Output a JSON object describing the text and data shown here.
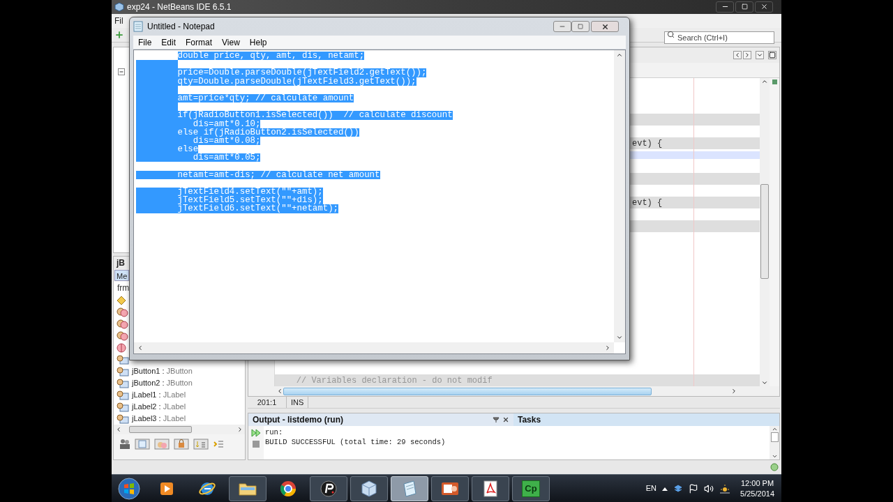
{
  "ide": {
    "title": "exp24 - NetBeans IDE 6.5.1",
    "menu": [
      "Fil"
    ],
    "search": {
      "placeholder": "Search (Ctrl+I)"
    },
    "inspector": {
      "header": "jB",
      "tabs": [
        {
          "label": "Me",
          "selected": true
        }
      ],
      "root": "frm",
      "items": [
        {
          "kind": "form"
        },
        {
          "kind": "bean"
        },
        {
          "kind": "bean"
        },
        {
          "kind": "bean"
        },
        {
          "kind": "separator"
        },
        {
          "kind": "component"
        },
        {
          "kind": "component",
          "name": "jButton1 :",
          "type": "JButton"
        },
        {
          "kind": "component",
          "name": "jButton2 :",
          "type": "JButton"
        },
        {
          "kind": "component",
          "name": "jLabel1 :",
          "type": "JLabel"
        },
        {
          "kind": "component",
          "name": "jLabel2 :",
          "type": "JLabel"
        },
        {
          "kind": "component",
          "name": "jLabel3 :",
          "type": "JLabel"
        }
      ]
    },
    "editor": {
      "rows": [
        {
          "guarded": false,
          "current": false
        },
        {
          "guarded": false,
          "current": false
        },
        {
          "guarded": false,
          "current": false
        },
        {
          "guarded": true,
          "current": false
        },
        {
          "guarded": false,
          "current": false
        },
        {
          "guarded": true,
          "current": false,
          "kind": "tail",
          "text": "evt) {"
        },
        {
          "guarded": false,
          "current": true
        },
        {
          "guarded": false,
          "current": false
        },
        {
          "guarded": true,
          "current": false
        },
        {
          "guarded": false,
          "current": false
        },
        {
          "guarded": true,
          "current": false,
          "kind": "tail",
          "text": "evt) {"
        },
        {
          "guarded": false,
          "current": false
        },
        {
          "guarded": true,
          "current": false
        },
        {
          "guarded": false,
          "current": false
        },
        {
          "guarded": false,
          "current": false
        },
        {
          "guarded": false,
          "current": false
        },
        {
          "guarded": false,
          "current": false
        },
        {
          "guarded": false,
          "current": false
        },
        {
          "guarded": false,
          "current": false
        },
        {
          "guarded": false,
          "current": false
        },
        {
          "guarded": false,
          "current": false
        },
        {
          "guarded": false,
          "current": false
        },
        {
          "guarded": false,
          "current": false
        },
        {
          "guarded": false,
          "current": false
        },
        {
          "guarded": false,
          "current": false
        },
        {
          "guarded": true,
          "current": false,
          "kind": "code",
          "text": "    // Variables declaration - do not modif"
        }
      ]
    },
    "status": {
      "position": "201:1",
      "mode": "INS"
    },
    "output": {
      "title": "Output - listdemo (run)",
      "tabs": [
        {
          "label": "Tasks",
          "selected": false
        }
      ],
      "lines": [
        "run:",
        "BUILD SUCCESSFUL (total time: 29 seconds)"
      ]
    }
  },
  "notepad": {
    "title": "Untitled - Notepad",
    "menu": [
      "File",
      "Edit",
      "Format",
      "View",
      "Help"
    ],
    "lines": [
      {
        "kind": "code",
        "text": "        double price, qty, amt, dis, netamt;",
        "lead_selected": false,
        "selected": true
      },
      {
        "kind": "blank",
        "selected": true
      },
      {
        "kind": "code",
        "text": "        price=Double.parseDouble(jTextField2.getText());",
        "lead_selected": true,
        "selected": true
      },
      {
        "kind": "code",
        "text": "        qty=Double.parseDouble(jTextField3.getText());",
        "lead_selected": true,
        "selected": true
      },
      {
        "kind": "blank",
        "selected": true
      },
      {
        "kind": "code",
        "text": "        amt=price*qty; // calculate amount",
        "lead_selected": true,
        "selected": true
      },
      {
        "kind": "blank",
        "selected": true
      },
      {
        "kind": "code",
        "text": "        if(jRadioButton1.isSelected())  // calculate discount",
        "lead_selected": true,
        "selected": true
      },
      {
        "kind": "code",
        "text": "           dis=amt*0.10;",
        "lead_selected": true,
        "selected": true
      },
      {
        "kind": "code",
        "text": "        else if(jRadioButton2.isSelected())",
        "lead_selected": true,
        "selected": true
      },
      {
        "kind": "code",
        "text": "           dis=amt*0.08;",
        "lead_selected": true,
        "selected": true
      },
      {
        "kind": "code",
        "text": "        else",
        "lead_selected": true,
        "selected": true
      },
      {
        "kind": "code",
        "text": "           dis=amt*0.05;",
        "lead_selected": true,
        "selected": true
      },
      {
        "kind": "blank",
        "selected": false
      },
      {
        "kind": "code",
        "text": "        netamt=amt-dis; // calculate net amount",
        "lead_selected": true,
        "selected": true
      },
      {
        "kind": "blank",
        "selected": false
      },
      {
        "kind": "code",
        "text": "        jTextField4.setText(\"\"+amt);",
        "lead_selected": true,
        "selected": true
      },
      {
        "kind": "code",
        "text": "        jTextField5.setText(\"\"+dis);",
        "lead_selected": true,
        "selected": true
      },
      {
        "kind": "code",
        "text": "        jTextField6.setText(\"\"+netamt);",
        "lead_selected": true,
        "selected": true
      }
    ]
  },
  "taskbar": {
    "apps": [
      {
        "running": false,
        "selected": false
      },
      {
        "running": false,
        "selected": false
      },
      {
        "running": true,
        "selected": false
      },
      {
        "running": false,
        "selected": false
      },
      {
        "running": true,
        "selected": false
      },
      {
        "running": true,
        "selected": false
      },
      {
        "running": true,
        "selected": true
      },
      {
        "running": true,
        "selected": false
      },
      {
        "running": true,
        "selected": false
      },
      {
        "running": true,
        "selected": false,
        "label": "Cp"
      }
    ],
    "language": "EN",
    "time": "12:00 PM",
    "date": "5/25/2014"
  }
}
